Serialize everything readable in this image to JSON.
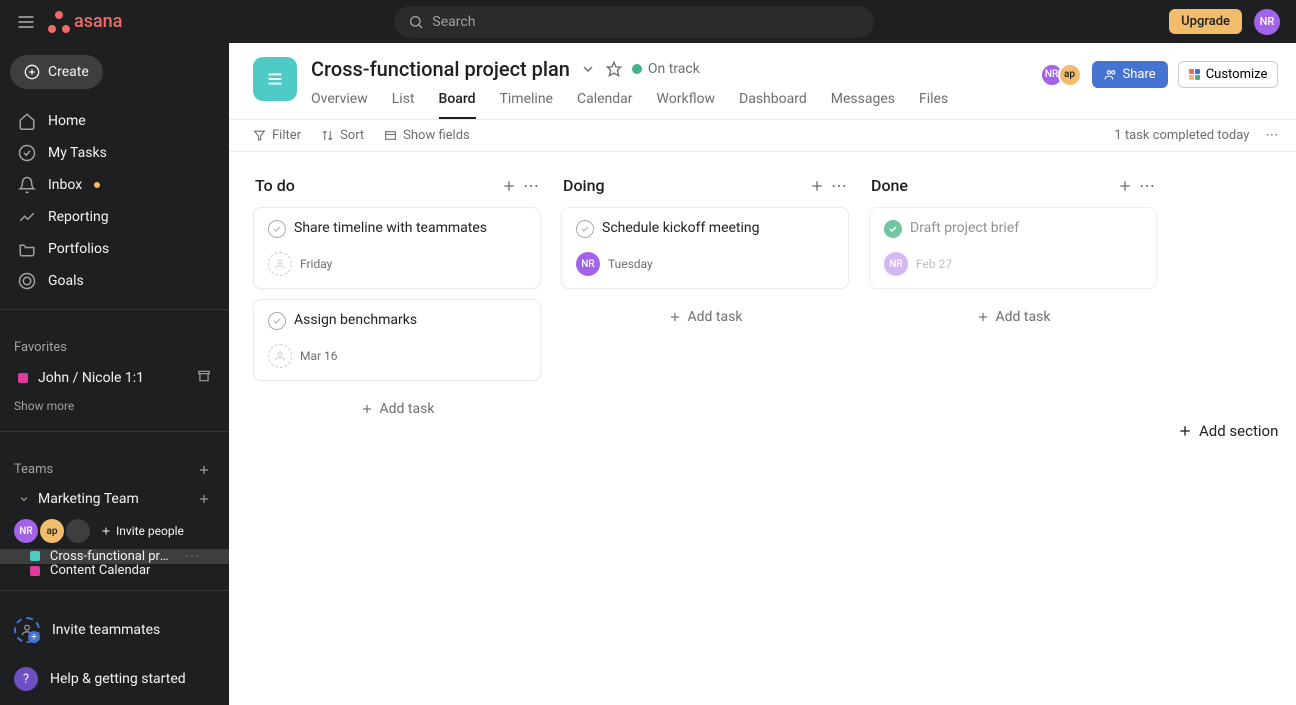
{
  "topbar": {
    "search_placeholder": "Search",
    "upgrade": "Upgrade",
    "user_initials": "NR",
    "logo_text": "asana"
  },
  "sidebar": {
    "create": "Create",
    "nav": {
      "home": "Home",
      "my_tasks": "My Tasks",
      "inbox": "Inbox",
      "reporting": "Reporting",
      "portfolios": "Portfolios",
      "goals": "Goals"
    },
    "favorites_label": "Favorites",
    "favorites": [
      {
        "name": "John / Nicole 1:1",
        "color": "#e5399e"
      }
    ],
    "show_more": "Show more",
    "teams_label": "Teams",
    "team": "Marketing Team",
    "invite_people": "Invite people",
    "projects": [
      {
        "name": "Cross-functional pro…",
        "color": "#4ecbc4",
        "active": true
      },
      {
        "name": "Content Calendar",
        "color": "#e5399e",
        "active": false
      }
    ],
    "invite_teammates": "Invite teammates",
    "help": "Help & getting started"
  },
  "project": {
    "title": "Cross-functional project plan",
    "status": "On track",
    "tabs": [
      "Overview",
      "List",
      "Board",
      "Timeline",
      "Calendar",
      "Workflow",
      "Dashboard",
      "Messages",
      "Files"
    ],
    "active_tab": "Board",
    "share": "Share",
    "customize": "Customize",
    "members": [
      "NR",
      "ap"
    ]
  },
  "toolbar": {
    "filter": "Filter",
    "sort": "Sort",
    "show_fields": "Show fields",
    "completed_today": "1 task completed today"
  },
  "board": {
    "columns": [
      {
        "title": "To do",
        "cards": [
          {
            "title": "Share timeline with teammates",
            "due": "Friday",
            "completed": false,
            "assignee": null
          },
          {
            "title": "Assign benchmarks",
            "due": "Mar 16",
            "completed": false,
            "assignee": null
          }
        ]
      },
      {
        "title": "Doing",
        "cards": [
          {
            "title": "Schedule kickoff meeting",
            "due": "Tuesday",
            "completed": false,
            "assignee": "NR"
          }
        ]
      },
      {
        "title": "Done",
        "cards": [
          {
            "title": "Draft project brief",
            "due": "Feb 27",
            "completed": true,
            "assignee": "NR"
          }
        ]
      }
    ],
    "add_task": "Add task",
    "add_section": "Add section"
  }
}
